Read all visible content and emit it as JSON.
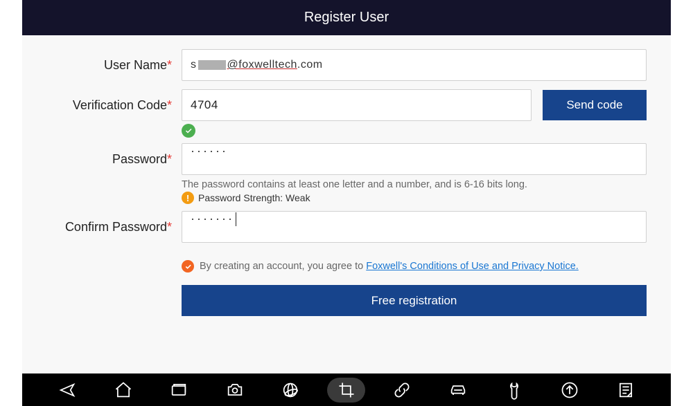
{
  "header": {
    "title": "Register User"
  },
  "form": {
    "username": {
      "label": "User Name",
      "prefix": "s",
      "domain_underlined": "@foxwelltech",
      "tld": ".com"
    },
    "verification": {
      "label": "Verification Code",
      "value": "4704",
      "send_button": "Send code"
    },
    "password": {
      "label": "Password",
      "masked": "······",
      "hint": "The password contains at least one letter and a number, and is 6-16 bits long.",
      "strength_label": "Password Strength: Weak"
    },
    "confirm": {
      "label": "Confirm Password",
      "masked": "·······"
    },
    "agreement": {
      "prefix": "By creating an account, you agree to ",
      "link": "Foxwell's Conditions of Use and Privacy Notice."
    },
    "submit": "Free registration"
  },
  "nav": {
    "back": "back-icon",
    "home": "home-icon",
    "recent": "recent-icon",
    "camera": "camera-icon",
    "browser": "browser-icon",
    "crop": "crop-icon",
    "link": "link-icon",
    "car": "car-icon",
    "tool": "tool-icon",
    "upload": "upload-icon",
    "list": "list-icon"
  }
}
